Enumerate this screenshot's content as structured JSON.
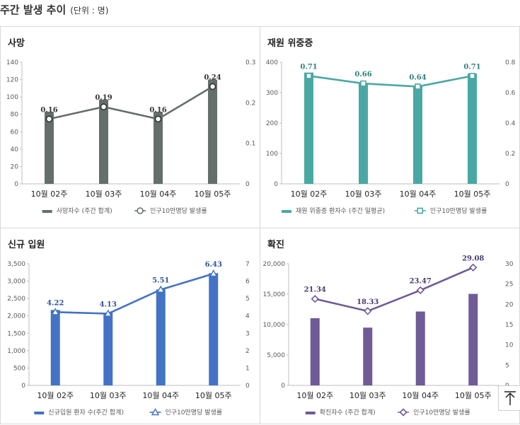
{
  "page": {
    "title": "주간 발생 추이",
    "unit": "(단위 : 명)"
  },
  "chart_data": [
    {
      "id": "deaths",
      "type": "bar+line",
      "title": "사망",
      "categories": [
        "10월 02주",
        "10월 03주",
        "10월 04주",
        "10월 05주"
      ],
      "series": [
        {
          "name": "사망자수 (주간 합계)",
          "type": "bar",
          "axis": "left",
          "values": [
            83,
            97,
            83,
            120
          ],
          "color": "#646e6a"
        },
        {
          "name": "인구10만명당 발생률",
          "type": "line",
          "axis": "right",
          "values": [
            0.16,
            0.19,
            0.16,
            0.24
          ],
          "labels": [
            "0.16",
            "0.19",
            "0.16",
            "0.24"
          ],
          "color": "#646e6a",
          "marker": "circle"
        }
      ],
      "ylim_left": [
        0,
        140
      ],
      "yticks_left": [
        "0",
        "20",
        "40",
        "60",
        "80",
        "100",
        "120",
        "140"
      ],
      "ylim_right": [
        0,
        0.3
      ],
      "yticks_right": [
        "0",
        "0.1",
        "0.2",
        "0.3"
      ],
      "label_color": "#333333"
    },
    {
      "id": "severe",
      "type": "bar+line",
      "title": "재원 위중증",
      "categories": [
        "10월 02주",
        "10월 03주",
        "10월 04주",
        "10월 05주"
      ],
      "series": [
        {
          "name": "재원 위중증 환자수 (주간 일평균)",
          "type": "bar",
          "axis": "left",
          "values": [
            366,
            331,
            321,
            363
          ],
          "color": "#4aa8a4"
        },
        {
          "name": "인구10만명당 발생률",
          "type": "line",
          "axis": "right",
          "values": [
            0.71,
            0.66,
            0.64,
            0.71
          ],
          "labels": [
            "0.71",
            "0.66",
            "0.64",
            "0.71"
          ],
          "color": "#4aa8a4",
          "marker": "square"
        }
      ],
      "ylim_left": [
        0,
        400
      ],
      "yticks_left": [
        "0",
        "100",
        "200",
        "300",
        "400"
      ],
      "ylim_right": [
        0,
        0.8
      ],
      "yticks_right": [
        "0",
        "0.2",
        "0.4",
        "0.6",
        "0.8"
      ],
      "label_color": "#2e7f7b"
    },
    {
      "id": "admissions",
      "type": "bar+line",
      "title": "신규 입원",
      "categories": [
        "10월 02주",
        "10월 03주",
        "10월 04주",
        "10월 05주"
      ],
      "series": [
        {
          "name": "신규입원 환자 수(주간 합계)",
          "type": "bar",
          "axis": "left",
          "values": [
            2170,
            2090,
            2760,
            3230
          ],
          "color": "#4472c4"
        },
        {
          "name": "인구10만명당 발생률",
          "type": "line",
          "axis": "right",
          "values": [
            4.22,
            4.13,
            5.51,
            6.43
          ],
          "labels": [
            "4.22",
            "4.13",
            "5.51",
            "6.43"
          ],
          "color": "#4472c4",
          "marker": "triangle"
        }
      ],
      "ylim_left": [
        0,
        3500
      ],
      "yticks_left": [
        "0",
        "500",
        "1,000",
        "1,500",
        "2,000",
        "2,500",
        "3,000",
        "3,500"
      ],
      "ylim_right": [
        0,
        7
      ],
      "yticks_right": [
        "0",
        "1",
        "2",
        "3",
        "4",
        "5",
        "6",
        "7"
      ],
      "label_color": "#2f5597"
    },
    {
      "id": "confirmed",
      "type": "bar+line",
      "title": "확진",
      "categories": [
        "10월 02주",
        "10월 03주",
        "10월 04주",
        "10월 05주"
      ],
      "series": [
        {
          "name": "확진자수 (주간 합계)",
          "type": "bar",
          "axis": "left",
          "values": [
            11050,
            9500,
            12150,
            15050
          ],
          "color": "#6f5b96"
        },
        {
          "name": "인구10만명당 발생률",
          "type": "line",
          "axis": "right",
          "values": [
            21.34,
            18.33,
            23.47,
            29.08
          ],
          "labels": [
            "21.34",
            "18.33",
            "23.47",
            "29.08"
          ],
          "color": "#6f5b96",
          "marker": "diamond"
        }
      ],
      "ylim_left": [
        0,
        20000
      ],
      "yticks_left": [
        "0",
        "5,000",
        "10,000",
        "15,000",
        "20,000"
      ],
      "ylim_right": [
        0,
        30
      ],
      "yticks_right": [
        "0",
        "5",
        "10",
        "15",
        "20",
        "25",
        "30"
      ],
      "label_color": "#4b3a70"
    }
  ],
  "top_button": {
    "icon": "arrow-up-icon"
  }
}
